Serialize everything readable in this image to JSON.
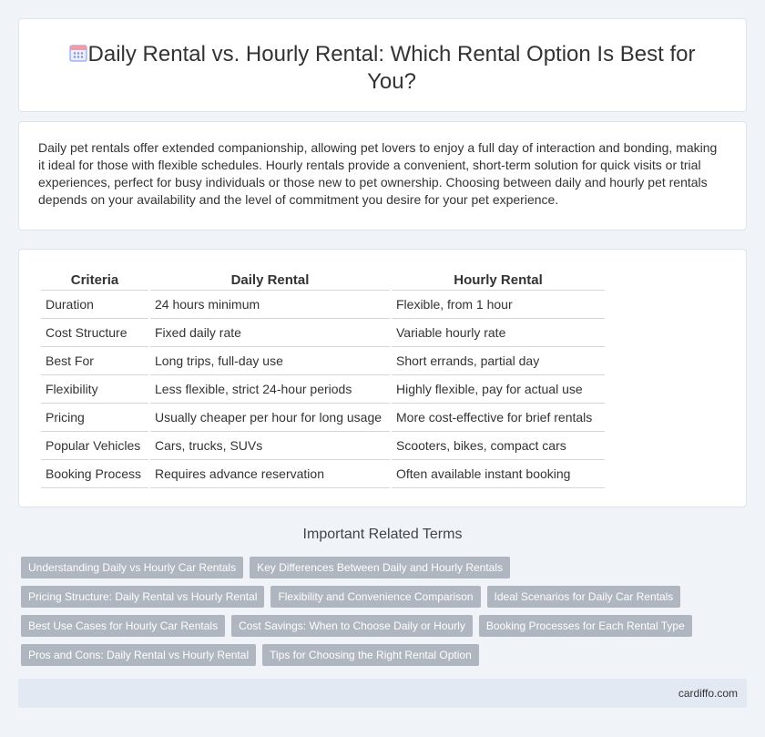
{
  "header": {
    "title": "Daily Rental vs. Hourly Rental: Which Rental Option Is Best for You?",
    "icon": "calendar-icon"
  },
  "intro": {
    "text": "Daily pet rentals offer extended companionship, allowing pet lovers to enjoy a full day of interaction and bonding, making it ideal for those with flexible schedules. Hourly rentals provide a convenient, short-term solution for quick visits or trial experiences, perfect for busy individuals or those new to pet ownership. Choosing between daily and hourly pet rentals depends on your availability and the level of commitment you desire for your pet experience."
  },
  "table": {
    "headers": [
      "Criteria",
      "Daily Rental",
      "Hourly Rental"
    ],
    "rows": [
      [
        "Duration",
        "24 hours minimum",
        "Flexible, from 1 hour"
      ],
      [
        "Cost Structure",
        "Fixed daily rate",
        "Variable hourly rate"
      ],
      [
        "Best For",
        "Long trips, full-day use",
        "Short errands, partial day"
      ],
      [
        "Flexibility",
        "Less flexible, strict 24-hour periods",
        "Highly flexible, pay for actual use"
      ],
      [
        "Pricing",
        "Usually cheaper per hour for long usage",
        "More cost-effective for brief rentals"
      ],
      [
        "Popular Vehicles",
        "Cars, trucks, SUVs",
        "Scooters, bikes, compact cars"
      ],
      [
        "Booking Process",
        "Requires advance reservation",
        "Often available instant booking"
      ]
    ]
  },
  "related": {
    "title": "Important Related Terms",
    "tags": [
      "Understanding Daily vs Hourly Car Rentals",
      "Key Differences Between Daily and Hourly Rentals",
      "Pricing Structure: Daily Rental vs Hourly Rental",
      "Flexibility and Convenience Comparison",
      "Ideal Scenarios for Daily Car Rentals",
      "Best Use Cases for Hourly Car Rentals",
      "Cost Savings: When to Choose Daily or Hourly",
      "Booking Processes for Each Rental Type",
      "Pros and Cons: Daily Rental vs Hourly Rental",
      "Tips for Choosing the Right Rental Option"
    ]
  },
  "footer": {
    "site": "cardiffo.com"
  },
  "colors": {
    "tag_bg": "#b0b6c0",
    "page_bg": "#f0f3f8",
    "footer_bg": "#e3e9f3"
  }
}
